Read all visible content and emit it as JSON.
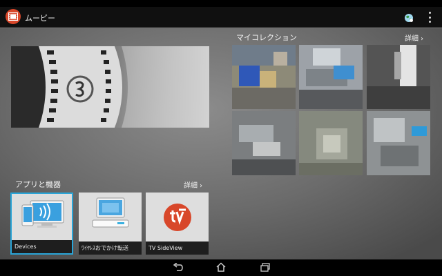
{
  "app": {
    "title": "ムービー",
    "icon": "film-icon",
    "accent": "#d8472a"
  },
  "actionbar": {
    "globe_icon": "globe-icon",
    "overflow_icon": "overflow-menu-icon"
  },
  "collection": {
    "title": "マイコレクション",
    "more": "詳細 ›"
  },
  "apps": {
    "title": "アプリと機器",
    "more": "詳細 ›",
    "items": [
      {
        "label": "Devices",
        "icon": "devices-icon",
        "selected": true
      },
      {
        "label": "ﾜｲﾔﾚｽおでかけ転送",
        "icon": "wireless-transfer-icon",
        "selected": false
      },
      {
        "label": "TV SideView",
        "icon": "tv-sideview-icon",
        "selected": false
      }
    ]
  },
  "nav": {
    "back": "back-icon",
    "home": "home-icon",
    "recents": "recent-apps-icon"
  },
  "colors": {
    "selection": "#29a5d8",
    "tv_sideview_red": "#d8472a"
  }
}
